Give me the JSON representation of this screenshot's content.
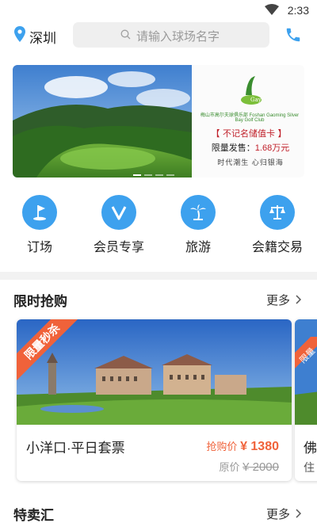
{
  "status": {
    "time": "2:33"
  },
  "header": {
    "city": "深圳",
    "search_placeholder": "请输入球场名字"
  },
  "banner": {
    "club_name": "梅山市高尔夫球俱乐部 Foshan Gaoming Silver Bay Golf Club",
    "slogan": "【 不记名储值卡 】",
    "price_label": "限量发售：",
    "price_value": "1.68万元",
    "tagline": "时代潮生  心归银海",
    "page_count": 4,
    "active_page": 1
  },
  "nav": [
    {
      "label": "订场",
      "icon": "golf-flag-icon"
    },
    {
      "label": "会员专享",
      "icon": "vip-v-icon"
    },
    {
      "label": "旅游",
      "icon": "palm-tree-icon"
    },
    {
      "label": "会籍交易",
      "icon": "scales-icon"
    }
  ],
  "flash_sale": {
    "title": "限时抢购",
    "more": "更多",
    "cards": [
      {
        "ribbon": "限量秒杀",
        "name": "小洋口·平日套票",
        "sale_label": "抢购价",
        "sale_price": "¥ 1380",
        "orig_label": "原价",
        "orig_price": "¥ 2000"
      },
      {
        "ribbon": "限量",
        "name": "佛",
        "sub": "住"
      }
    ]
  },
  "special": {
    "title": "特卖汇",
    "more": "更多"
  },
  "colors": {
    "accent": "#3da1ee",
    "sale": "#f0623a"
  }
}
